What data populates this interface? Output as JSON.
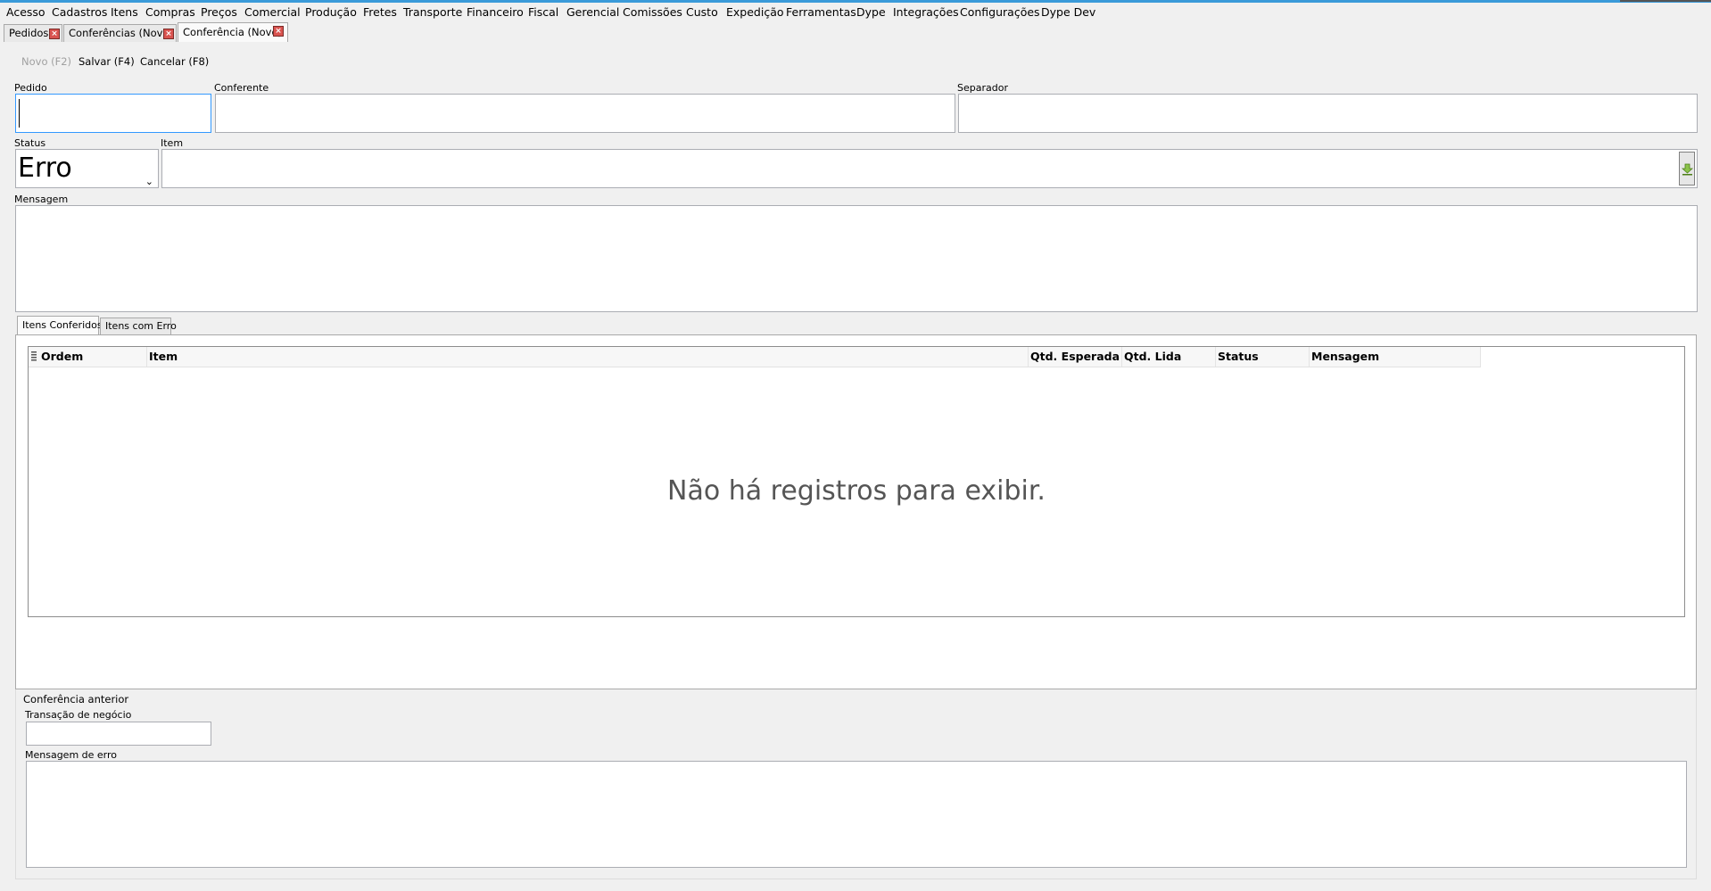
{
  "menu": {
    "items": [
      "Acesso",
      "Cadastros",
      "Itens",
      "Compras",
      "Preços",
      "Comercial",
      "Produção",
      "Fretes",
      "Transporte",
      "Financeiro",
      "Fiscal",
      "Gerencial",
      "Comissões",
      "Custo",
      "Expedição",
      "Ferramentas",
      "Dype",
      "Integrações",
      "Configurações",
      "Dype Dev"
    ]
  },
  "doc_tabs": [
    {
      "label": "Pedidos",
      "active": false
    },
    {
      "label": "Conferências (Novo)",
      "active": false
    },
    {
      "label": "Conferência (Novo)",
      "active": true
    }
  ],
  "toolbar": {
    "new_label": "Novo (F2)",
    "save_label": "Salvar (F4)",
    "cancel_label": "Cancelar (F8)"
  },
  "form": {
    "pedido_label": "Pedido",
    "pedido_value": "",
    "conferente_label": "Conferente",
    "conferente_value": "",
    "separador_label": "Separador",
    "separador_value": "",
    "status_label": "Status",
    "status_value": "Erro",
    "item_label": "Item",
    "item_value": "",
    "mensagem_label": "Mensagem",
    "mensagem_value": ""
  },
  "sub_tabs": [
    {
      "label": "Itens Conferidos",
      "active": true
    },
    {
      "label": "Itens com Erro",
      "active": false
    }
  ],
  "grid": {
    "columns": [
      "Ordem",
      "Item",
      "Qtd. Esperada",
      "Qtd. Lida",
      "Status",
      "Mensagem"
    ],
    "rows": [],
    "empty_message": "Não há registros para exibir."
  },
  "previous": {
    "group_label": "Conferência anterior",
    "transacao_label": "Transação de negócio",
    "transacao_value": "",
    "mensagem_erro_label": "Mensagem de erro",
    "mensagem_erro_value": ""
  },
  "colors": {
    "accent": "#3a9ad9",
    "close_button": "#d9534f",
    "focus_border": "#3399ff",
    "lookup_icon": "#6aa121"
  }
}
